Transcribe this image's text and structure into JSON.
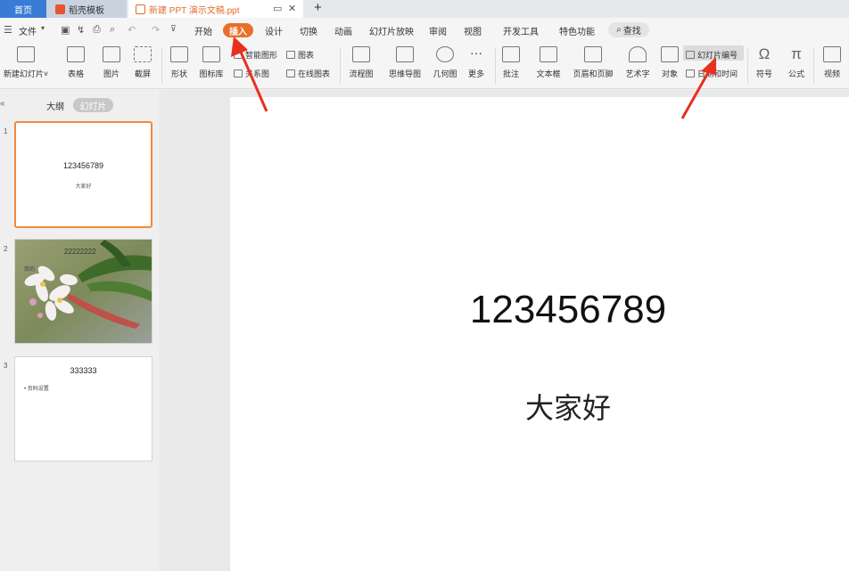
{
  "tabs": {
    "home": "首页",
    "template": "稻壳模板",
    "document": "新建 PPT 演示文稿.ppt",
    "new_tab": "+"
  },
  "menu": {
    "file": "文件",
    "items": [
      "开始",
      "插入",
      "设计",
      "切换",
      "动画",
      "幻灯片放映",
      "审阅",
      "视图",
      "开发工具",
      "特色功能"
    ],
    "active": "插入",
    "search": "查找"
  },
  "ribbon": {
    "new_slide": "新建幻灯片",
    "table": "表格",
    "picture": "图片",
    "screenshot": "截屏",
    "shape": "形状",
    "icon_library": "图标库",
    "smart_art": "智能图形",
    "relation_chart": "关系图",
    "chart": "图表",
    "online_chart": "在线图表",
    "flowchart": "流程图",
    "mind_map": "思维导图",
    "geometry": "几何图",
    "more": "更多",
    "comment": "批注",
    "textbox": "文本框",
    "header_footer": "页眉和页脚",
    "art_text": "艺术字",
    "object": "对象",
    "slide_number": "幻灯片编号",
    "date_time": "日期和时间",
    "symbol": "符号",
    "formula": "公式",
    "video": "视频"
  },
  "sidebar": {
    "outline_tab": "大纲",
    "slides_tab": "幻灯片",
    "thumbs": [
      {
        "num": "1",
        "title": "123456789",
        "subtitle": "大家好"
      },
      {
        "num": "2",
        "title": "22222222",
        "subtitle": "我的"
      },
      {
        "num": "3",
        "title": "333333",
        "bullet": "• 页码设置"
      }
    ]
  },
  "slide": {
    "title": "123456789",
    "subtitle": "大家好"
  },
  "colors": {
    "accent": "#e8702a",
    "home_tab": "#3a7bd5",
    "arrow": "#e8301e"
  }
}
